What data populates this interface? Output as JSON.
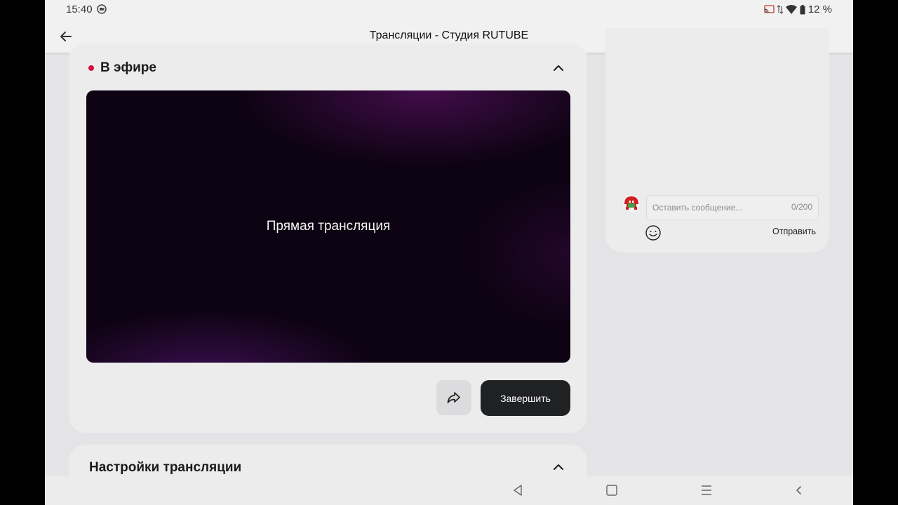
{
  "status_bar": {
    "time": "15:40",
    "battery": "12 %",
    "icons": [
      "screen-record-icon",
      "cast-icon",
      "data-arrows-icon",
      "wifi-icon",
      "battery-icon"
    ]
  },
  "app_bar": {
    "title": "Трансляции - Студия RUTUBE",
    "back_icon": "arrow-left-icon"
  },
  "live_section": {
    "status_label": "В эфире",
    "status_color": "#d0123c",
    "player_text": "Прямая трансляция",
    "share_icon": "share-arrow-icon",
    "finish_label": "Завершить"
  },
  "settings_section": {
    "title": "Настройки трансляции"
  },
  "chat": {
    "placeholder": "Оставить сообщение...",
    "counter": "0/200",
    "send_label": "Отправить",
    "emoji_icon": "smiley-icon"
  },
  "nav_bar": {
    "icons": [
      "back-triangle-icon",
      "home-square-icon",
      "menu-lines-icon",
      "chevron-left-icon"
    ]
  },
  "colors": {
    "accent_live": "#d0123c",
    "button_dark": "#202123",
    "background": "#e4e4e6"
  }
}
